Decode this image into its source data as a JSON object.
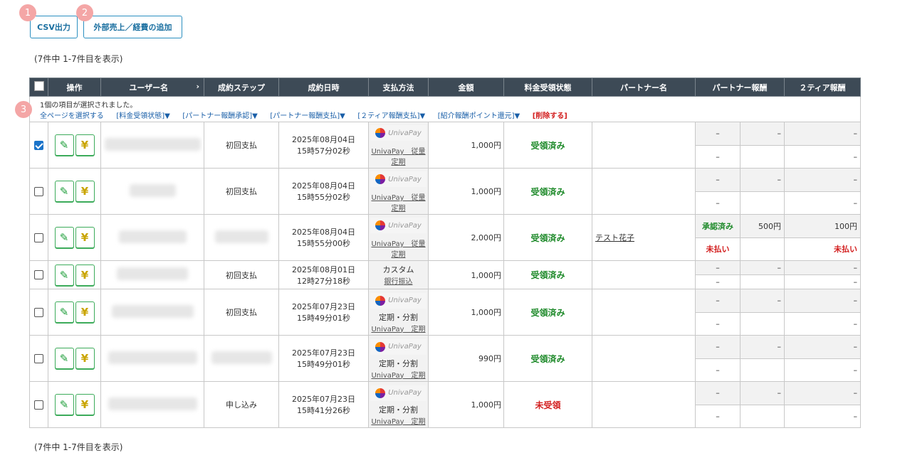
{
  "buttons": {
    "csv": "CSV出力",
    "external": "外部売上／経費の追加"
  },
  "badges": [
    "1",
    "2",
    "3"
  ],
  "count_text": "(7件中 1-7件目を表示)",
  "columns": [
    "操作",
    "ユーザー名",
    "›",
    "成約ステップ",
    "成約日時",
    "支払方法",
    "金額",
    "料金受領状態",
    "パートナー名",
    "パートナー報酬",
    "２ティア報酬"
  ],
  "selection": {
    "message": "1個の項目が選択されました。",
    "links": [
      "全ページを選択する",
      "[料金受領状態]▼",
      "[パートナー報酬承認]▼",
      "[パートナー報酬支払]▼",
      "[２ティア報酬支払]▼",
      "[紹介報酬ポイント還元]▼"
    ],
    "delete": "[削除する]"
  },
  "logo_text": "UnivaPay",
  "dash": "–",
  "rows": [
    {
      "step": "初回支払",
      "date": "2025年08月04日",
      "time": "15時57分02秒",
      "pay_top": "",
      "pay_link": "UnivaPay　従量",
      "pay_link2": "定期",
      "amount": "1,000円",
      "status": "受領済み",
      "partner": "",
      "r1": "–",
      "r2": "–",
      "r3": "–",
      "r4": "–",
      "r5": "",
      "r6": "–"
    },
    {
      "step": "初回支払",
      "date": "2025年08月04日",
      "time": "15時55分02秒",
      "pay_top": "",
      "pay_link": "UnivaPay　従量",
      "pay_link2": "定期",
      "amount": "1,000円",
      "status": "受領済み",
      "partner": "",
      "r1": "–",
      "r2": "–",
      "r3": "–",
      "r4": "–",
      "r5": "",
      "r6": "–"
    },
    {
      "step": "",
      "date": "2025年08月04日",
      "time": "15時55分00秒",
      "pay_top": "",
      "pay_link": "UnivaPay　従量",
      "pay_link2": "定期",
      "amount": "2,000円",
      "status": "受領済み",
      "partner": "テスト花子",
      "r1": "承認済み",
      "r2": "500円",
      "r3": "100円",
      "r4": "未払い",
      "r5": "",
      "r6": "未払い"
    },
    {
      "step": "初回支払",
      "date": "2025年08月01日",
      "time": "12時27分18秒",
      "pay_top": "カスタム",
      "pay_link": "銀行振込",
      "pay_link2": "",
      "amount": "1,000円",
      "status": "受領済み",
      "partner": "",
      "r1": "–",
      "r2": "–",
      "r3": "–",
      "r4": "–",
      "r5": "",
      "r6": "–"
    },
    {
      "step": "初回支払",
      "date": "2025年07月23日",
      "time": "15時49分01秒",
      "pay_top": "定期・分割",
      "pay_link": "UnivaPay　定期",
      "pay_link2": "",
      "amount": "1,000円",
      "status": "受領済み",
      "partner": "",
      "r1": "–",
      "r2": "–",
      "r3": "–",
      "r4": "–",
      "r5": "",
      "r6": "–"
    },
    {
      "step": "",
      "date": "2025年07月23日",
      "time": "15時49分01秒",
      "pay_top": "定期・分割",
      "pay_link": "UnivaPay　定期",
      "pay_link2": "",
      "amount": "990円",
      "status": "受領済み",
      "partner": "",
      "r1": "–",
      "r2": "–",
      "r3": "–",
      "r4": "–",
      "r5": "",
      "r6": "–"
    },
    {
      "step": "申し込み",
      "date": "2025年07月23日",
      "time": "15時41分26秒",
      "pay_top": "定期・分割",
      "pay_link": "UnivaPay　定期",
      "pay_link2": "",
      "amount": "1,000円",
      "status": "未受領",
      "partner": "",
      "r1": "–",
      "r2": "–",
      "r3": "–",
      "r4": "–",
      "r5": "",
      "r6": "–"
    }
  ]
}
